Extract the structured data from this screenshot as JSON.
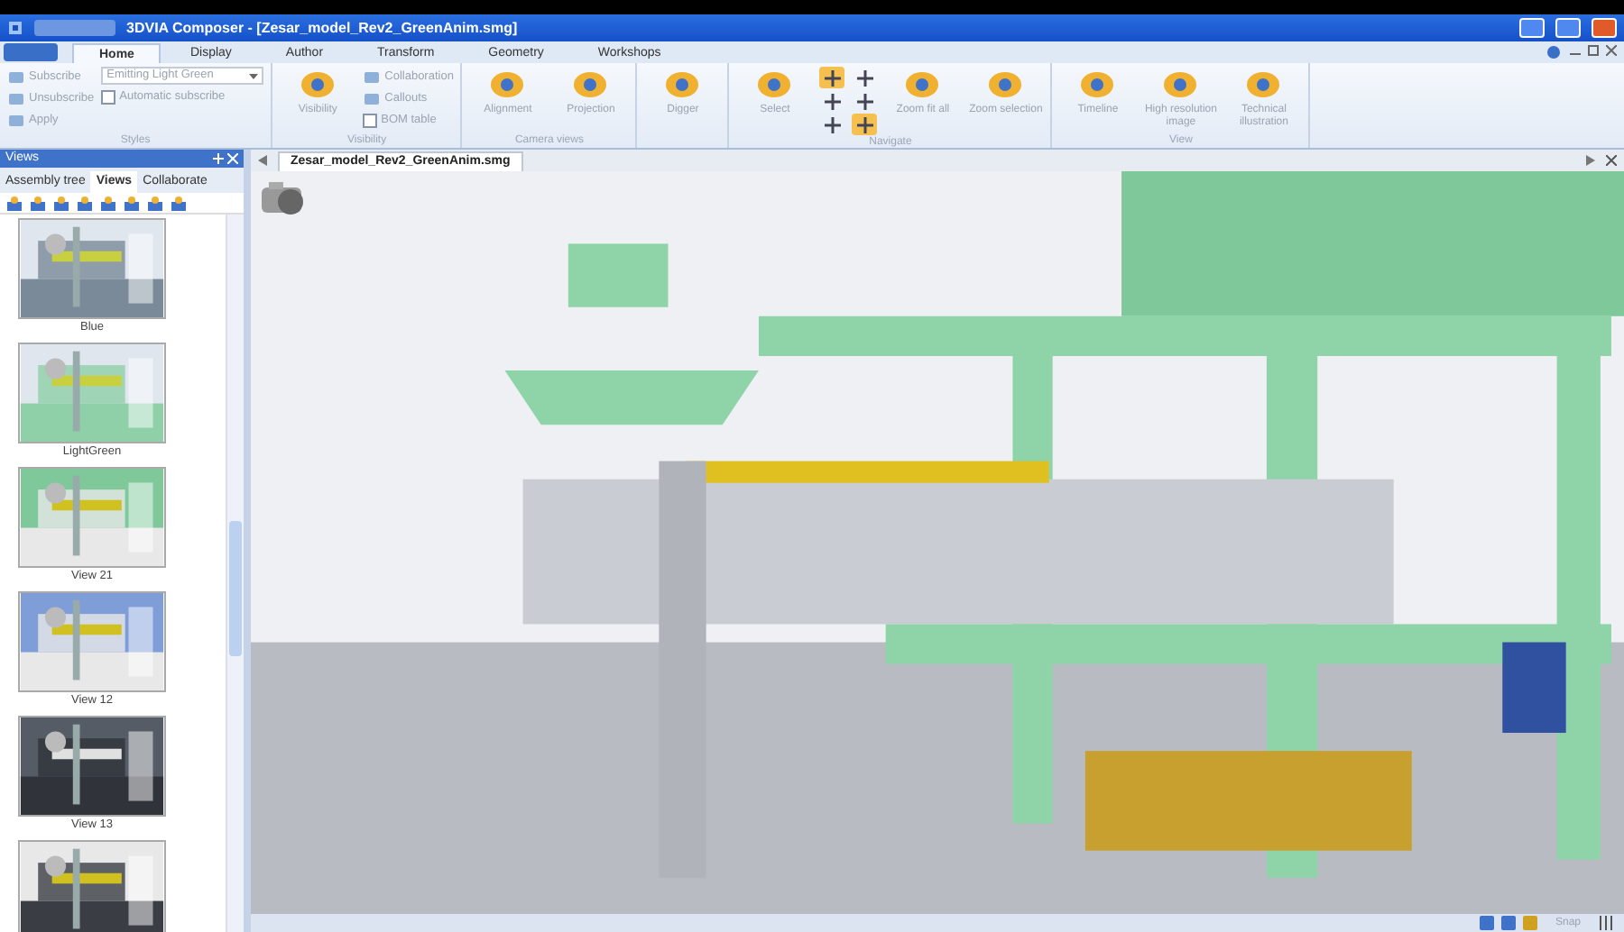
{
  "window": {
    "title": "3DVIA Composer - [Zesar_model_Rev2_GreenAnim.smg]"
  },
  "ribbon_tabs": [
    {
      "label": "Home",
      "selected": true
    },
    {
      "label": "Display",
      "selected": false
    },
    {
      "label": "Author",
      "selected": false
    },
    {
      "label": "Transform",
      "selected": false
    },
    {
      "label": "Geometry",
      "selected": false
    },
    {
      "label": "Workshops",
      "selected": false
    }
  ],
  "ribbon_groups": [
    {
      "label": "Styles",
      "items": [
        {
          "kind": "small",
          "label": "Subscribe",
          "disabled": true
        },
        {
          "kind": "small",
          "label": "Unsubscribe",
          "disabled": true
        },
        {
          "kind": "small",
          "label": "Apply",
          "disabled": true
        },
        {
          "kind": "dropdown",
          "value": "Emitting Light Green",
          "disabled": true
        },
        {
          "kind": "check",
          "label": "Automatic subscribe",
          "checked": false,
          "disabled": true
        }
      ]
    },
    {
      "label": "Visibility",
      "items": [
        {
          "kind": "large",
          "label": "Visibility",
          "disabled": true
        },
        {
          "kind": "small",
          "label": "Collaboration",
          "disabled": true
        },
        {
          "kind": "small",
          "label": "Callouts",
          "disabled": true
        },
        {
          "kind": "check",
          "label": "BOM table",
          "checked": false,
          "disabled": true
        }
      ]
    },
    {
      "label": "Camera views",
      "items": [
        {
          "kind": "large",
          "label": "Alignment",
          "disabled": true
        },
        {
          "kind": "large",
          "label": "Projection",
          "disabled": true
        }
      ]
    },
    {
      "items": [
        {
          "kind": "large",
          "label": "Digger",
          "disabled": true
        }
      ]
    },
    {
      "label": "Navigate",
      "items": [
        {
          "kind": "large",
          "label": "Select",
          "disabled": true
        },
        {
          "kind": "tool",
          "selected": true
        },
        {
          "kind": "tool",
          "selected": false
        },
        {
          "kind": "tool",
          "selected": false
        },
        {
          "kind": "tool",
          "selected": false
        },
        {
          "kind": "tool",
          "selected": false
        },
        {
          "kind": "tool",
          "selected": true
        },
        {
          "kind": "large",
          "label": "Zoom fit all",
          "disabled": true
        },
        {
          "kind": "large",
          "label": "Zoom selection",
          "disabled": true
        }
      ]
    },
    {
      "label": "View",
      "items": [
        {
          "kind": "large",
          "label": "Timeline",
          "disabled": true
        },
        {
          "kind": "large",
          "label": "High resolution image",
          "disabled": true
        },
        {
          "kind": "large",
          "label": "Technical illustration",
          "disabled": true
        }
      ]
    }
  ],
  "panel": {
    "title": "Views",
    "tabs": [
      {
        "label": "Assembly tree",
        "selected": false
      },
      {
        "label": "Views",
        "selected": true
      },
      {
        "label": "Collaborate",
        "selected": false
      }
    ],
    "views": [
      {
        "kind": "picture",
        "label": "Blue"
      },
      {
        "kind": "picture",
        "label": "LightGreen"
      },
      {
        "kind": "picture",
        "label": "View 21"
      },
      {
        "kind": "picture",
        "label": "View 12"
      },
      {
        "kind": "picture",
        "label": "View 13"
      },
      {
        "kind": "picture"
      }
    ]
  },
  "document_tab": {
    "label": "Zesar_model_Rev2_GreenAnim.smg"
  },
  "status_bar": {
    "snap": "Snap"
  }
}
